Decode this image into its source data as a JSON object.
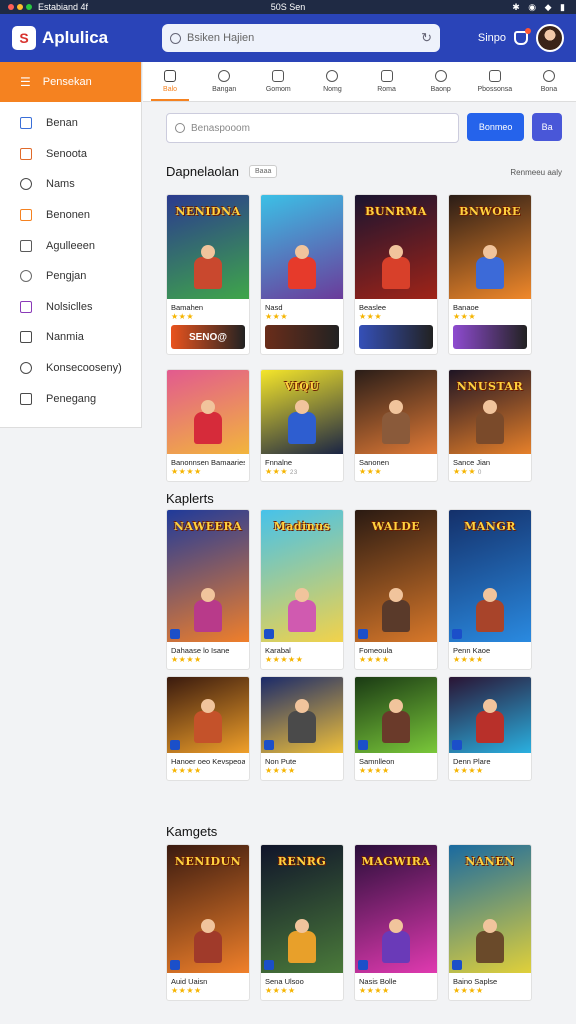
{
  "status_bar": {
    "carrier": "Estabiand 4f",
    "time": "50S Sen",
    "icons": "✱ ◉ ◆ ▮"
  },
  "header": {
    "app_name": "Aplulica",
    "logo_letter": "S",
    "search_text": "Bsiken Hajien",
    "profile_label": "Sinpo"
  },
  "sidebar": {
    "active_label": "Pensekan",
    "items": [
      {
        "label": "Benan",
        "icon": "monitor-icon",
        "color": "#3a6fd8"
      },
      {
        "label": "Senoota",
        "icon": "store-icon",
        "color": "#e06a2a"
      },
      {
        "label": "Nams",
        "icon": "compass-icon",
        "color": "#4a4a4a"
      },
      {
        "label": "Benonen",
        "icon": "gift-icon",
        "color": "#f58220"
      },
      {
        "label": "Agulleeen",
        "icon": "sliders-icon",
        "color": "#5a5a5a"
      },
      {
        "label": "Pengjan",
        "icon": "pen-icon",
        "color": "#6a6a6a"
      },
      {
        "label": "Nolsiclles",
        "icon": "puzzle-icon",
        "color": "#8a3ab8"
      },
      {
        "label": "Nanmia",
        "icon": "box-icon",
        "color": "#4a4a4a"
      },
      {
        "label": "Konsecooseny)",
        "icon": "cart-icon",
        "color": "#4a4a4a"
      },
      {
        "label": "Penegang",
        "icon": "book-icon",
        "color": "#4a4a4a"
      }
    ]
  },
  "tabs": [
    {
      "label": "Balo",
      "icon": "home-icon",
      "active": true
    },
    {
      "label": "Bangan",
      "icon": "game-icon",
      "active": false
    },
    {
      "label": "Gomom",
      "icon": "bookmark-icon",
      "active": false
    },
    {
      "label": "Nomg",
      "icon": "chat-icon",
      "active": false
    },
    {
      "label": "Roma",
      "icon": "rocket-icon",
      "active": false
    },
    {
      "label": "Baonp",
      "icon": "list-icon",
      "active": false
    },
    {
      "label": "Pbossonsa",
      "icon": "globe-icon",
      "active": false
    },
    {
      "label": "Bona",
      "icon": "calendar-icon",
      "active": false
    }
  ],
  "main": {
    "search_placeholder": "Benaspooom",
    "primary_button": "Bonmeo",
    "secondary_button": "Ba",
    "see_all": "Renmeeu aaly"
  },
  "sections": [
    {
      "title": "Dapnelaolan",
      "pill": "Baaa",
      "cards": [
        {
          "title_art": "NENIDNA",
          "name": "Bamahen",
          "stars": "★★★",
          "count": "",
          "bg1": "#2b3a8f",
          "bg2": "#3fa64a",
          "hero": "#c9482e",
          "promo": "SENO@",
          "promo_bg": "#e9531e"
        },
        {
          "title_art": "",
          "name": "Nasd",
          "stars": "★★★",
          "count": "",
          "bg1": "#3cc0e6",
          "bg2": "#6b3b9a",
          "hero": "#e63a2b",
          "promo": "",
          "promo_bg": "#6a2d1a"
        },
        {
          "title_art": "BUNRMA",
          "name": "Beaslee",
          "stars": "★★★",
          "count": "",
          "bg1": "#1a1430",
          "bg2": "#a02418",
          "hero": "#d8402a",
          "promo": "",
          "promo_bg": "#3550b8"
        },
        {
          "title_art": "BNWORE",
          "name": "Banaoe",
          "stars": "★★★",
          "count": "",
          "bg1": "#2a1c16",
          "bg2": "#f0882a",
          "hero": "#3c6ad8",
          "promo": "",
          "promo_bg": "#8e4bd0"
        },
        {
          "title_art": "",
          "name": "Banonnsen Bamaaries",
          "stars": "★★★★",
          "count": "",
          "bg1": "#e25a8f",
          "bg2": "#f2b53c",
          "hero": "#d62b3a",
          "promo": "",
          "promo_bg": ""
        },
        {
          "title_art": "VIQU",
          "name": "Fnnalne",
          "stars": "★★★",
          "count": "23",
          "bg1": "#f5e62a",
          "bg2": "#1a2444",
          "hero": "#2e5ed0",
          "promo": "",
          "promo_bg": ""
        },
        {
          "title_art": "",
          "name": "Sanonen",
          "stars": "★★★",
          "count": "",
          "bg1": "#2a1d18",
          "bg2": "#e07a36",
          "hero": "#8a5a3a",
          "promo": "",
          "promo_bg": ""
        },
        {
          "title_art": "NNUSTAR",
          "name": "Sance Jian",
          "stars": "★★★",
          "count": "0",
          "bg1": "#1e1424",
          "bg2": "#e6802a",
          "hero": "#7a4a2a",
          "promo": "",
          "promo_bg": ""
        }
      ]
    },
    {
      "title": "Kaplerts",
      "pill": "",
      "cards": [
        {
          "title_art": "NAWEERA",
          "name": "Dahaase lo Isane",
          "stars": "★★★★",
          "count": "",
          "bg1": "#1f3a9a",
          "bg2": "#f07f2a",
          "hero": "#b83a8a",
          "promo": "",
          "promo_bg": ""
        },
        {
          "title_art": "Madinus",
          "name": "Karabal",
          "stars": "★★★★★",
          "count": "",
          "bg1": "#46c2ea",
          "bg2": "#f2d24a",
          "hero": "#d05ab0",
          "promo": "",
          "promo_bg": ""
        },
        {
          "title_art": "WALDE",
          "name": "Fomeoula",
          "stars": "★★★★",
          "count": "",
          "bg1": "#2a1a12",
          "bg2": "#d8782a",
          "hero": "#5a3a2a",
          "promo": "",
          "promo_bg": ""
        },
        {
          "title_art": "MANGR",
          "name": "Penn Kaoe",
          "stars": "★★★★",
          "count": "",
          "bg1": "#14306a",
          "bg2": "#2a8ae0",
          "hero": "#a8442a",
          "promo": "",
          "promo_bg": ""
        },
        {
          "title_art": "",
          "name": "Hanoer oeo Kevspeoait",
          "stars": "★★★★",
          "count": "",
          "bg1": "#3a1a0e",
          "bg2": "#f0a02a",
          "hero": "#c4522a",
          "promo": "",
          "promo_bg": ""
        },
        {
          "title_art": "",
          "name": "Non Pute",
          "stars": "★★★★",
          "count": "",
          "bg1": "#1a2a6a",
          "bg2": "#f0c03a",
          "hero": "#4a4a4a",
          "promo": "",
          "promo_bg": ""
        },
        {
          "title_art": "",
          "name": "Samnlleon",
          "stars": "★★★★",
          "count": "",
          "bg1": "#1a3a14",
          "bg2": "#7ac83a",
          "hero": "#6a3a2a",
          "promo": "",
          "promo_bg": ""
        },
        {
          "title_art": "",
          "name": "Denn Plare",
          "stars": "★★★★",
          "count": "",
          "bg1": "#2a1434",
          "bg2": "#2ab0e0",
          "hero": "#b8302a",
          "promo": "",
          "promo_bg": ""
        }
      ]
    },
    {
      "title": "Kamgets",
      "pill": "",
      "cards": [
        {
          "title_art": "NENIDUN",
          "name": "Auid Uaisn",
          "stars": "★★★★",
          "count": "",
          "bg1": "#3a1a10",
          "bg2": "#f0802a",
          "hero": "#a03a2a",
          "promo": "",
          "promo_bg": ""
        },
        {
          "title_art": "RENRG",
          "name": "Sena Ulsoo",
          "stars": "★★★★",
          "count": "",
          "bg1": "#10142a",
          "bg2": "#4a7a3a",
          "hero": "#e8a02a",
          "promo": "",
          "promo_bg": ""
        },
        {
          "title_art": "MAGWIRA",
          "name": "Nasis Bolle",
          "stars": "★★★★",
          "count": "",
          "bg1": "#2a0e3a",
          "bg2": "#e03ab0",
          "hero": "#6a3ab8",
          "promo": "",
          "promo_bg": ""
        },
        {
          "title_art": "NANEN",
          "name": "Baino Saplse",
          "stars": "★★★★",
          "count": "",
          "bg1": "#1a6aa0",
          "bg2": "#e0d03a",
          "hero": "#6a4a2a",
          "promo": "",
          "promo_bg": ""
        }
      ]
    }
  ]
}
